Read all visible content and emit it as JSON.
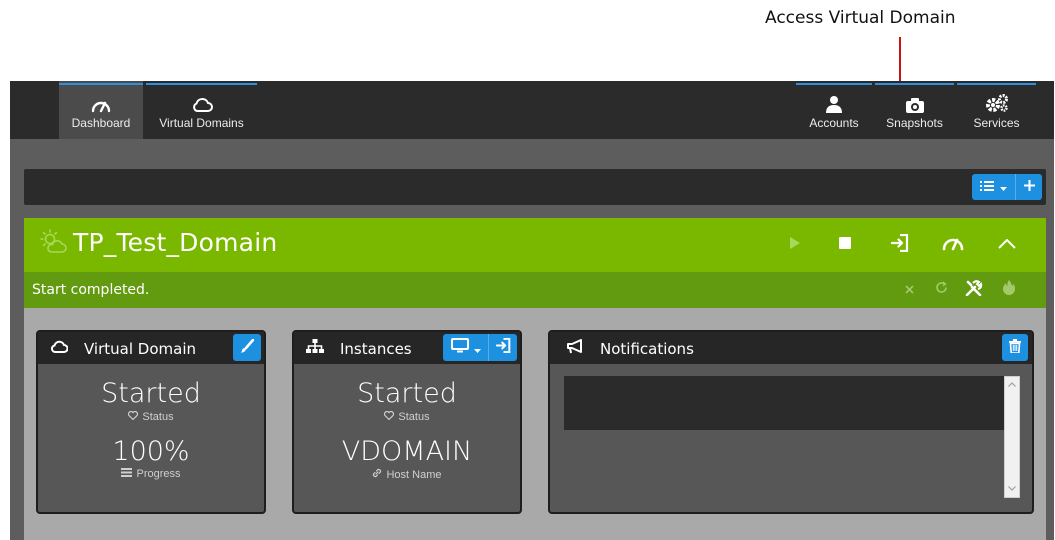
{
  "annotation": {
    "label": "Access Virtual Domain"
  },
  "nav": {
    "left": [
      {
        "label": "Dashboard",
        "icon": "gauge-icon",
        "active": true
      },
      {
        "label": "Virtual Domains",
        "icon": "cloud-icon",
        "active": false
      }
    ],
    "right": [
      {
        "label": "Accounts",
        "icon": "user-icon"
      },
      {
        "label": "Snapshots",
        "icon": "camera-icon"
      },
      {
        "label": "Services",
        "icon": "gears-icon"
      }
    ]
  },
  "toolbar": {
    "list_icon": "list-icon",
    "add_icon": "plus-icon"
  },
  "domain": {
    "name": "TP_Test_Domain",
    "status_message": "Start completed.",
    "colors": {
      "header": "#7ab800",
      "status_bar": "#629a10",
      "accent": "#1e90e0"
    },
    "actions": [
      "play-icon",
      "stop-icon",
      "sign-in-icon",
      "gauge-icon",
      "chevron-up-icon"
    ],
    "status_actions": [
      "close-icon",
      "refresh-icon",
      "tools-icon",
      "fire-icon"
    ]
  },
  "panels": {
    "virtual_domain": {
      "title": "Virtual Domain",
      "status_value": "Started",
      "status_label": "Status",
      "progress_value": "100%",
      "progress_label": "Progress"
    },
    "instances": {
      "title": "Instances",
      "status_value": "Started",
      "status_label": "Status",
      "host_value": "VDOMAIN",
      "host_label": "Host Name"
    },
    "notifications": {
      "title": "Notifications"
    }
  }
}
